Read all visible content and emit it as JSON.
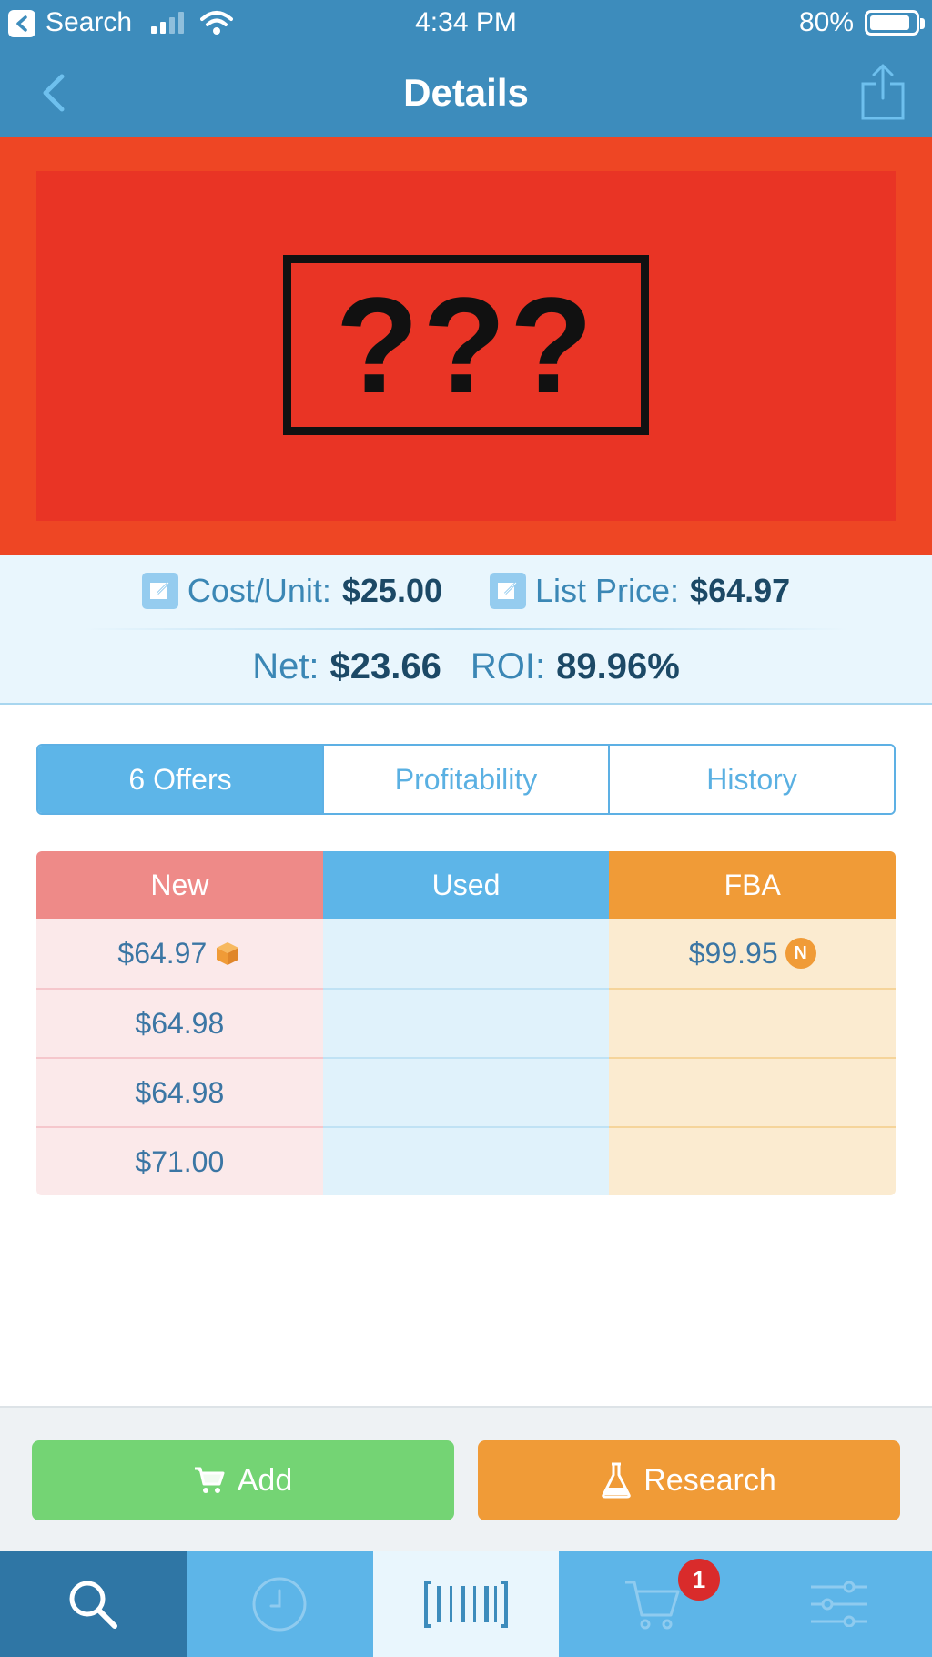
{
  "status_bar": {
    "back_app": "Search",
    "time": "4:34 PM",
    "battery": "80%"
  },
  "nav": {
    "title": "Details"
  },
  "product_image": {
    "placeholder_text": "???"
  },
  "summary": {
    "cost_label": "Cost/Unit:",
    "cost_value": "$25.00",
    "list_label": "List Price:",
    "list_value": "$64.97",
    "net_label": "Net:",
    "net_value": "$23.66",
    "roi_label": "ROI:",
    "roi_value": "89.96%"
  },
  "tabs": [
    {
      "label": "6 Offers",
      "active": true
    },
    {
      "label": "Profitability",
      "active": false
    },
    {
      "label": "History",
      "active": false
    }
  ],
  "offers": {
    "columns": [
      "New",
      "Used",
      "FBA"
    ],
    "new": [
      "$64.97",
      "$64.98",
      "$64.98",
      "$71.00"
    ],
    "used": [
      "",
      "",
      "",
      ""
    ],
    "fba": [
      "$99.95",
      "",
      "",
      ""
    ],
    "fba_badge": "N"
  },
  "actions": {
    "add_label": "Add",
    "research_label": "Research"
  },
  "tabbar": {
    "items": [
      "search-icon",
      "clock-icon",
      "barcode-icon",
      "cart-icon",
      "sliders-icon"
    ],
    "cart_badge": "1"
  },
  "colors": {
    "header": "#3d8cbc",
    "accent_blue": "#5db5e8",
    "new_red": "#ee8a88",
    "fba_orange": "#f09b37",
    "add_green": "#74d474"
  }
}
